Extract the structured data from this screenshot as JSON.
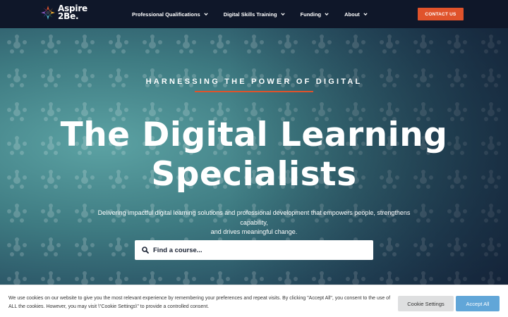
{
  "header": {
    "logo": {
      "line1": "Aspire",
      "line2": "2Be.",
      "icon": "aspire-logo-icon"
    },
    "nav": [
      {
        "label": "Professional Qualifications",
        "icon": "chevron-down-icon"
      },
      {
        "label": "Digital Skills Training",
        "icon": "chevron-down-icon"
      },
      {
        "label": "Funding",
        "icon": "chevron-down-icon"
      },
      {
        "label": "About",
        "icon": "chevron-down-icon"
      }
    ],
    "contact_label": "CONTACT US"
  },
  "hero": {
    "eyebrow": "HARNESSING THE POWER OF DIGITAL",
    "headline_line1": "The Digital Learning",
    "headline_line2": "Specialists",
    "subtext_line1": "Delivering impactful digital learning solutions and professional development that empowers people, strengthens capability,",
    "subtext_line2": "and drives meaningful change.",
    "search": {
      "placeholder": "Find a course...",
      "value": "",
      "icon": "search-icon"
    }
  },
  "cookie": {
    "text_line1": "We use cookies on our website to give you the most relevant experience by remembering your preferences and repeat visits. By clicking \"Accept All\", you consent to the use of",
    "text_line2": "ALL the cookies. However, you may visit \\\"Cookie Settings\\\" to provide a controlled consent.",
    "settings_label": "Cookie Settings",
    "accept_label": "Accept All"
  },
  "colors": {
    "header_bg": "#0f1729",
    "accent": "#e0532b",
    "accept_button": "#61a6d8",
    "hero_teal": "#5fa8a8"
  }
}
